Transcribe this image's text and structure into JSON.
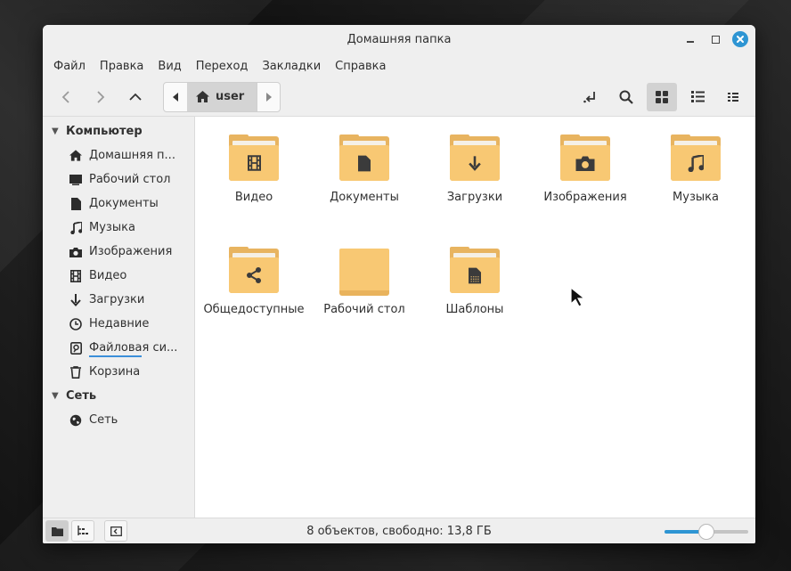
{
  "window": {
    "title": "Домашняя папка"
  },
  "menu": [
    "Файл",
    "Правка",
    "Вид",
    "Переход",
    "Закладки",
    "Справка"
  ],
  "path": {
    "current": "user"
  },
  "sidebar": {
    "computer_heading": "Компьютер",
    "items": [
      {
        "label": "Домашняя п...",
        "icon": "home-icon"
      },
      {
        "label": "Рабочий стол",
        "icon": "desktop-icon"
      },
      {
        "label": "Документы",
        "icon": "document-icon"
      },
      {
        "label": "Музыка",
        "icon": "music-icon"
      },
      {
        "label": "Изображения",
        "icon": "camera-icon"
      },
      {
        "label": "Видео",
        "icon": "film-icon"
      },
      {
        "label": "Загрузки",
        "icon": "download-icon"
      },
      {
        "label": "Недавние",
        "icon": "clock-icon"
      },
      {
        "label": "Файловая си...",
        "icon": "drive-icon"
      },
      {
        "label": "Корзина",
        "icon": "trash-icon"
      }
    ],
    "network_heading": "Сеть",
    "network_items": [
      {
        "label": "Сеть",
        "icon": "globe-icon"
      }
    ],
    "filesystem_usage": 0.7
  },
  "files": [
    {
      "label": "Видео",
      "icon": "film-icon"
    },
    {
      "label": "Документы",
      "icon": "document-icon"
    },
    {
      "label": "Загрузки",
      "icon": "download-icon"
    },
    {
      "label": "Изображения",
      "icon": "camera-icon"
    },
    {
      "label": "Музыка",
      "icon": "music-icon"
    },
    {
      "label": "Общедоступные",
      "icon": "share-icon"
    },
    {
      "label": "Рабочий стол",
      "icon": "desktop-folder-icon"
    },
    {
      "label": "Шаблоны",
      "icon": "template-icon"
    }
  ],
  "status": {
    "text": "8 объектов, свободно: 13,8 ГБ",
    "zoom_level": 0.5
  },
  "colors": {
    "accent": "#2e95d3",
    "folder": "#f8c873",
    "folder_dark": "#e8b460"
  }
}
